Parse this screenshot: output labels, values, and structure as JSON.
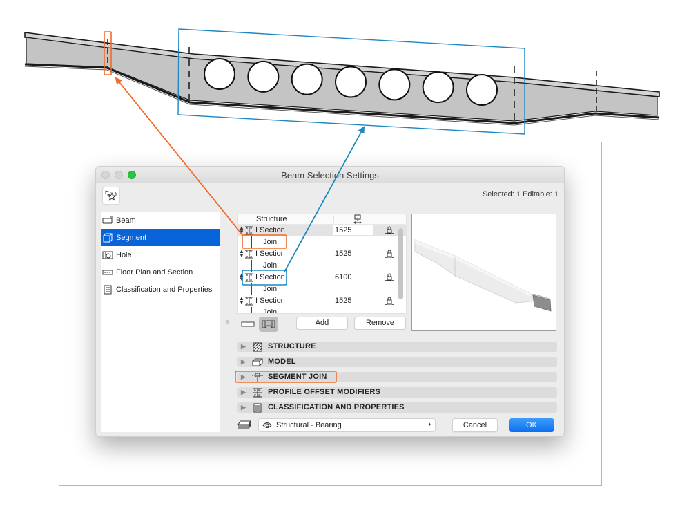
{
  "illustration": {
    "beam_hole_count": 7,
    "annotation_colors": {
      "orange": "#f26b2a",
      "blue": "#1c87c0"
    },
    "beam_fill": "#c4c4c4"
  },
  "window": {
    "title": "Beam Selection Settings",
    "selected_info": "Selected: 1 Editable: 1",
    "favorites_icon": "favorites-star-icon"
  },
  "sidebar": {
    "items": [
      {
        "label": "Beam",
        "icon": "beam-icon",
        "active": false
      },
      {
        "label": "Segment",
        "icon": "segment-icon",
        "active": true
      },
      {
        "label": "Hole",
        "icon": "hole-icon",
        "active": false
      },
      {
        "label": "Floor Plan and Section",
        "icon": "floor-plan-icon",
        "active": false
      },
      {
        "label": "Classification and Properties",
        "icon": "classification-icon",
        "active": false
      }
    ]
  },
  "segment_list": {
    "headers": {
      "structure": "Structure",
      "length_icon": "length-icon"
    },
    "rows": [
      {
        "type": "section",
        "label": "I Section",
        "length": "1525",
        "selected": true,
        "highlight": ""
      },
      {
        "type": "join",
        "label": "Join",
        "highlight": "orange"
      },
      {
        "type": "section",
        "label": "I Section",
        "length": "1525",
        "selected": false,
        "highlight": ""
      },
      {
        "type": "join",
        "label": "Join",
        "highlight": ""
      },
      {
        "type": "section",
        "label": "I Section",
        "length": "6100",
        "selected": false,
        "highlight": "blue"
      },
      {
        "type": "join",
        "label": "Join",
        "highlight": ""
      },
      {
        "type": "section",
        "label": "I Section",
        "length": "1525",
        "selected": false,
        "highlight": ""
      },
      {
        "type": "join",
        "label": "Join",
        "highlight": ""
      }
    ],
    "add_label": "Add",
    "remove_label": "Remove"
  },
  "panels": [
    {
      "label": "STRUCTURE",
      "icon": "structure-hatch-icon",
      "highlight": false
    },
    {
      "label": "MODEL",
      "icon": "model-icon",
      "highlight": false
    },
    {
      "label": "SEGMENT JOIN",
      "icon": "segment-join-icon",
      "highlight": true
    },
    {
      "label": "PROFILE OFFSET MODIFIERS",
      "icon": "profile-offset-icon",
      "highlight": false
    },
    {
      "label": "CLASSIFICATION AND PROPERTIES",
      "icon": "classification-icon",
      "highlight": false
    }
  ],
  "footer": {
    "layer_value": "Structural - Bearing",
    "cancel_label": "Cancel",
    "ok_label": "OK"
  }
}
